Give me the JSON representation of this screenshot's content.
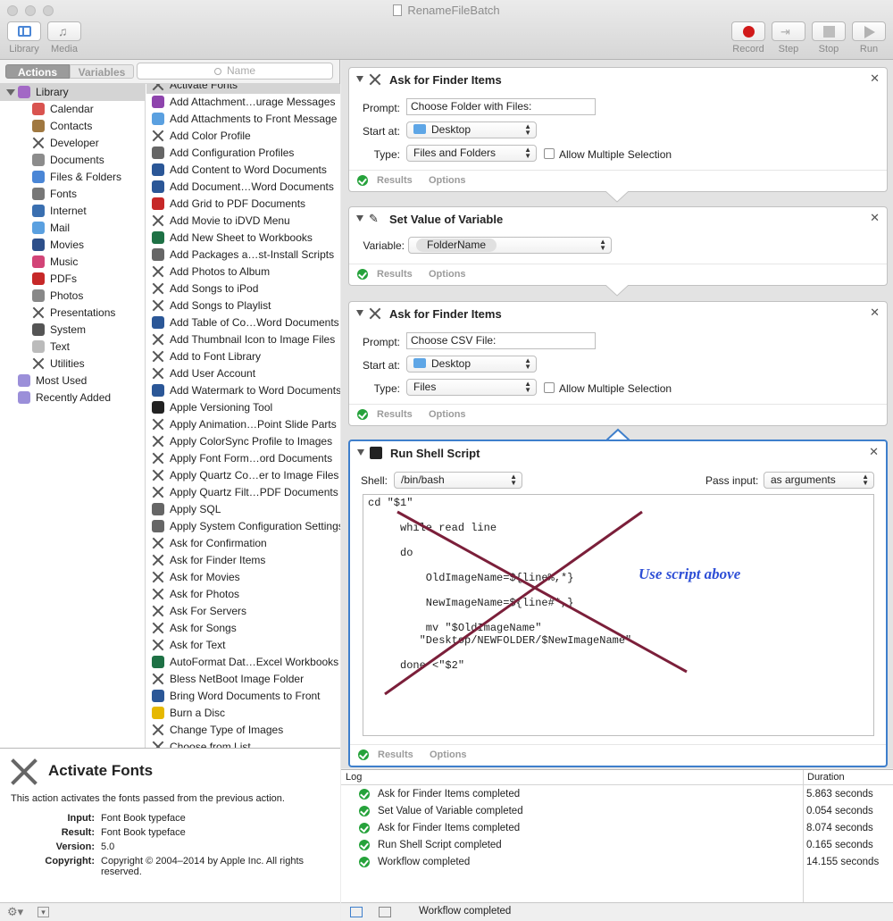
{
  "window": {
    "title": "RenameFileBatch"
  },
  "toolbar": {
    "library": "Library",
    "media": "Media",
    "record": "Record",
    "step": "Step",
    "stop": "Stop",
    "run": "Run",
    "record_color": "#d11a1a"
  },
  "left": {
    "tabs": [
      "Actions",
      "Variables"
    ],
    "search_placeholder": "Name",
    "library_label": "Library",
    "categories": [
      {
        "label": "Calendar",
        "icon": "calendar-icon",
        "color": "#d9534f"
      },
      {
        "label": "Contacts",
        "icon": "contacts-icon",
        "color": "#a07840"
      },
      {
        "label": "Developer",
        "icon": "tools-icon",
        "color": "x"
      },
      {
        "label": "Documents",
        "icon": "documents-icon",
        "color": "#8c8c8c"
      },
      {
        "label": "Files & Folders",
        "icon": "finder-icon",
        "color": "#4a86d6"
      },
      {
        "label": "Fonts",
        "icon": "fontbook-icon",
        "color": "#777777"
      },
      {
        "label": "Internet",
        "icon": "globe-icon",
        "color": "#3a6fb0"
      },
      {
        "label": "Mail",
        "icon": "mail-icon",
        "color": "#5aa0e0"
      },
      {
        "label": "Movies",
        "icon": "quicktime-icon",
        "color": "#2d4f8a"
      },
      {
        "label": "Music",
        "icon": "itunes-icon",
        "color": "#d24477"
      },
      {
        "label": "PDFs",
        "icon": "pdf-icon",
        "color": "#c62828"
      },
      {
        "label": "Photos",
        "icon": "photos-icon",
        "color": "#888888"
      },
      {
        "label": "Presentations",
        "icon": "tools-icon",
        "color": "x"
      },
      {
        "label": "System",
        "icon": "system-icon",
        "color": "#555555"
      },
      {
        "label": "Text",
        "icon": "text-icon",
        "color": "#bbbbbb"
      },
      {
        "label": "Utilities",
        "icon": "tools-icon",
        "color": "x"
      }
    ],
    "smart_groups": [
      {
        "label": "Most Used",
        "icon": "smart-folder-icon",
        "color": "#9b8fd9"
      },
      {
        "label": "Recently Added",
        "icon": "smart-folder-icon",
        "color": "#9b8fd9"
      }
    ],
    "actions": [
      {
        "label": "Activate Fonts",
        "icon": "x"
      },
      {
        "label": "Add Attachment…urage Messages",
        "icon": "#8e44ad"
      },
      {
        "label": "Add Attachments to Front Message",
        "icon": "#5aa0e0"
      },
      {
        "label": "Add Color Profile",
        "icon": "x"
      },
      {
        "label": "Add Configuration Profiles",
        "icon": "#666666"
      },
      {
        "label": "Add Content to Word Documents",
        "icon": "#2b5797"
      },
      {
        "label": "Add Document…Word Documents",
        "icon": "#2b5797"
      },
      {
        "label": "Add Grid to PDF Documents",
        "icon": "#c62828"
      },
      {
        "label": "Add Movie to iDVD Menu",
        "icon": "x"
      },
      {
        "label": "Add New Sheet to Workbooks",
        "icon": "#1e7145"
      },
      {
        "label": "Add Packages a…st-Install Scripts",
        "icon": "#666666"
      },
      {
        "label": "Add Photos to Album",
        "icon": "x"
      },
      {
        "label": "Add Songs to iPod",
        "icon": "x"
      },
      {
        "label": "Add Songs to Playlist",
        "icon": "x"
      },
      {
        "label": "Add Table of Co…Word Documents",
        "icon": "#2b5797"
      },
      {
        "label": "Add Thumbnail Icon to Image Files",
        "icon": "x"
      },
      {
        "label": "Add to Font Library",
        "icon": "x"
      },
      {
        "label": "Add User Account",
        "icon": "x"
      },
      {
        "label": "Add Watermark to Word Documents",
        "icon": "#2b5797"
      },
      {
        "label": "Apple Versioning Tool",
        "icon": "#222222"
      },
      {
        "label": "Apply Animation…Point Slide Parts",
        "icon": "x"
      },
      {
        "label": "Apply ColorSync Profile to Images",
        "icon": "x"
      },
      {
        "label": "Apply Font Form…ord Documents",
        "icon": "x"
      },
      {
        "label": "Apply Quartz Co…er to Image Files",
        "icon": "x"
      },
      {
        "label": "Apply Quartz Filt…PDF Documents",
        "icon": "x"
      },
      {
        "label": "Apply SQL",
        "icon": "#666666"
      },
      {
        "label": "Apply System Configuration Settings",
        "icon": "#666666"
      },
      {
        "label": "Ask for Confirmation",
        "icon": "x"
      },
      {
        "label": "Ask for Finder Items",
        "icon": "x"
      },
      {
        "label": "Ask for Movies",
        "icon": "x"
      },
      {
        "label": "Ask for Photos",
        "icon": "x"
      },
      {
        "label": "Ask For Servers",
        "icon": "x"
      },
      {
        "label": "Ask for Songs",
        "icon": "x"
      },
      {
        "label": "Ask for Text",
        "icon": "x"
      },
      {
        "label": "AutoFormat Dat…Excel Workbooks",
        "icon": "#1e7145"
      },
      {
        "label": "Bless NetBoot Image Folder",
        "icon": "x"
      },
      {
        "label": "Bring Word Documents to Front",
        "icon": "#2b5797"
      },
      {
        "label": "Burn a Disc",
        "icon": "#e6b800"
      },
      {
        "label": "Change Type of Images",
        "icon": "x"
      },
      {
        "label": "Choose from List",
        "icon": "x"
      }
    ],
    "description": {
      "title": "Activate Fonts",
      "text": "This action activates the fonts passed from the previous action.",
      "fields": [
        {
          "key": "Input:",
          "value": "Font Book typeface"
        },
        {
          "key": "Result:",
          "value": "Font Book typeface"
        },
        {
          "key": "Version:",
          "value": "5.0"
        },
        {
          "key": "Copyright:",
          "value": "Copyright © 2004–2014 by Apple Inc. All rights reserved."
        }
      ]
    }
  },
  "workflow": {
    "footer_results": "Results",
    "footer_options": "Options",
    "action1": {
      "title": "Ask for Finder Items",
      "prompt_label": "Prompt:",
      "prompt_value": "Choose Folder with Files:",
      "start_label": "Start at:",
      "start_value": "Desktop",
      "type_label": "Type:",
      "type_value": "Files and Folders",
      "multiple_label": "Allow Multiple Selection"
    },
    "action2": {
      "title": "Set Value of Variable",
      "variable_label": "Variable:",
      "variable_value": "FolderName"
    },
    "action3": {
      "title": "Ask for Finder Items",
      "prompt_label": "Prompt:",
      "prompt_value": "Choose CSV File:",
      "start_label": "Start at:",
      "start_value": "Desktop",
      "type_label": "Type:",
      "type_value": "Files",
      "multiple_label": "Allow Multiple Selection"
    },
    "action4": {
      "title": "Run Shell Script",
      "shell_label": "Shell:",
      "shell_value": "/bin/bash",
      "pass_label": "Pass input:",
      "pass_value": "as arguments",
      "script": "cd \"$1\"\n\n     while read line\n\n     do\n\n         OldImageName=${line%,*}\n\n         NewImageName=${line#*,}\n\n         mv \"$OldImageName\"\n        \"Desktop/NEWFOLDER/$NewImageName\"\n\n     done <\"$2\"",
      "annotation": "Use script above",
      "annotation_color": "#2e4fd6",
      "cross_color": "#7b1f3a"
    }
  },
  "log": {
    "col_log": "Log",
    "col_duration": "Duration",
    "rows": [
      {
        "message": "Ask for Finder Items completed",
        "duration": "5.863 seconds"
      },
      {
        "message": "Set Value of Variable completed",
        "duration": "0.054 seconds"
      },
      {
        "message": "Ask for Finder Items completed",
        "duration": "8.074 seconds"
      },
      {
        "message": "Run Shell Script completed",
        "duration": "0.165 seconds"
      },
      {
        "message": "Workflow completed",
        "duration": "14.155 seconds"
      }
    ],
    "status": "Workflow completed"
  }
}
